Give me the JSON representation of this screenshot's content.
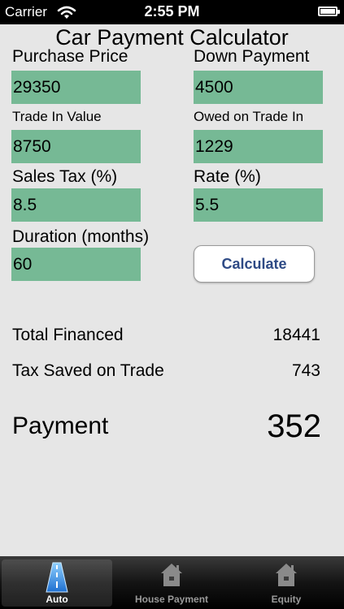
{
  "status_bar": {
    "carrier": "Carrier",
    "time": "2:55 PM"
  },
  "title": "Car Payment Calculator",
  "inputs": {
    "purchase_price": {
      "label": "Purchase Price",
      "value": "29350"
    },
    "down_payment": {
      "label": "Down Payment",
      "value": "4500"
    },
    "trade_in_value": {
      "label": "Trade In Value",
      "value": "8750"
    },
    "owed_on_trade_in": {
      "label": "Owed on Trade In",
      "value": "1229"
    },
    "sales_tax": {
      "label": "Sales Tax (%)",
      "value": "8.5"
    },
    "rate": {
      "label": "Rate (%)",
      "value": "5.5"
    },
    "duration": {
      "label": "Duration (months)",
      "value": "60"
    }
  },
  "calculate_button": "Calculate",
  "results": {
    "total_financed": {
      "label": "Total Financed",
      "value": "18441"
    },
    "tax_saved": {
      "label": "Tax Saved on Trade",
      "value": "743"
    },
    "payment": {
      "label": "Payment",
      "value": "352"
    }
  },
  "tabs": [
    {
      "label": "Auto",
      "icon": "road-icon",
      "active": true
    },
    {
      "label": "House Payment",
      "icon": "house-icon",
      "active": false
    },
    {
      "label": "Equity",
      "icon": "house-icon",
      "active": false
    }
  ],
  "colors": {
    "field_background": "#76b995",
    "button_text": "#2e4a85",
    "background": "#e6e6e6",
    "tab_bar": "#141414"
  }
}
